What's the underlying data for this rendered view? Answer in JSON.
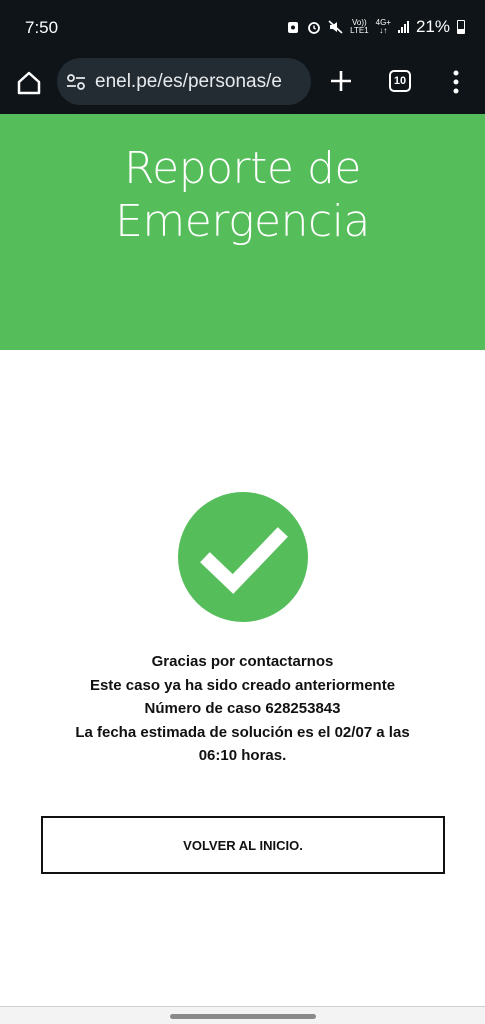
{
  "status_bar": {
    "time": "7:50",
    "net_top": "Vo))",
    "net_bottom": "LTE1",
    "net2_top": "4G+",
    "net2_bottom": "↓↑",
    "battery": "21%"
  },
  "browser": {
    "url": "enel.pe/es/personas/e",
    "tab_count": "10"
  },
  "hero": {
    "title_line1": "Reporte de",
    "title_line2": "Emergencia"
  },
  "result": {
    "line1": "Gracias por contactarnos",
    "line2": "Este caso ya ha sido creado anteriormente",
    "line3": "Número de caso 628253843",
    "line4": "La fecha estimada de solución es el 02/07 a las",
    "line5": "06:10 horas."
  },
  "actions": {
    "back_label": "VOLVER AL INICIO."
  },
  "colors": {
    "brand_green": "#55be5a",
    "chrome_dark": "#0f1418",
    "url_pill": "#232c33"
  },
  "icons": [
    "home-icon",
    "site-settings-icon",
    "plus-icon",
    "tabs-icon",
    "more-vert-icon",
    "checkmark-icon"
  ]
}
